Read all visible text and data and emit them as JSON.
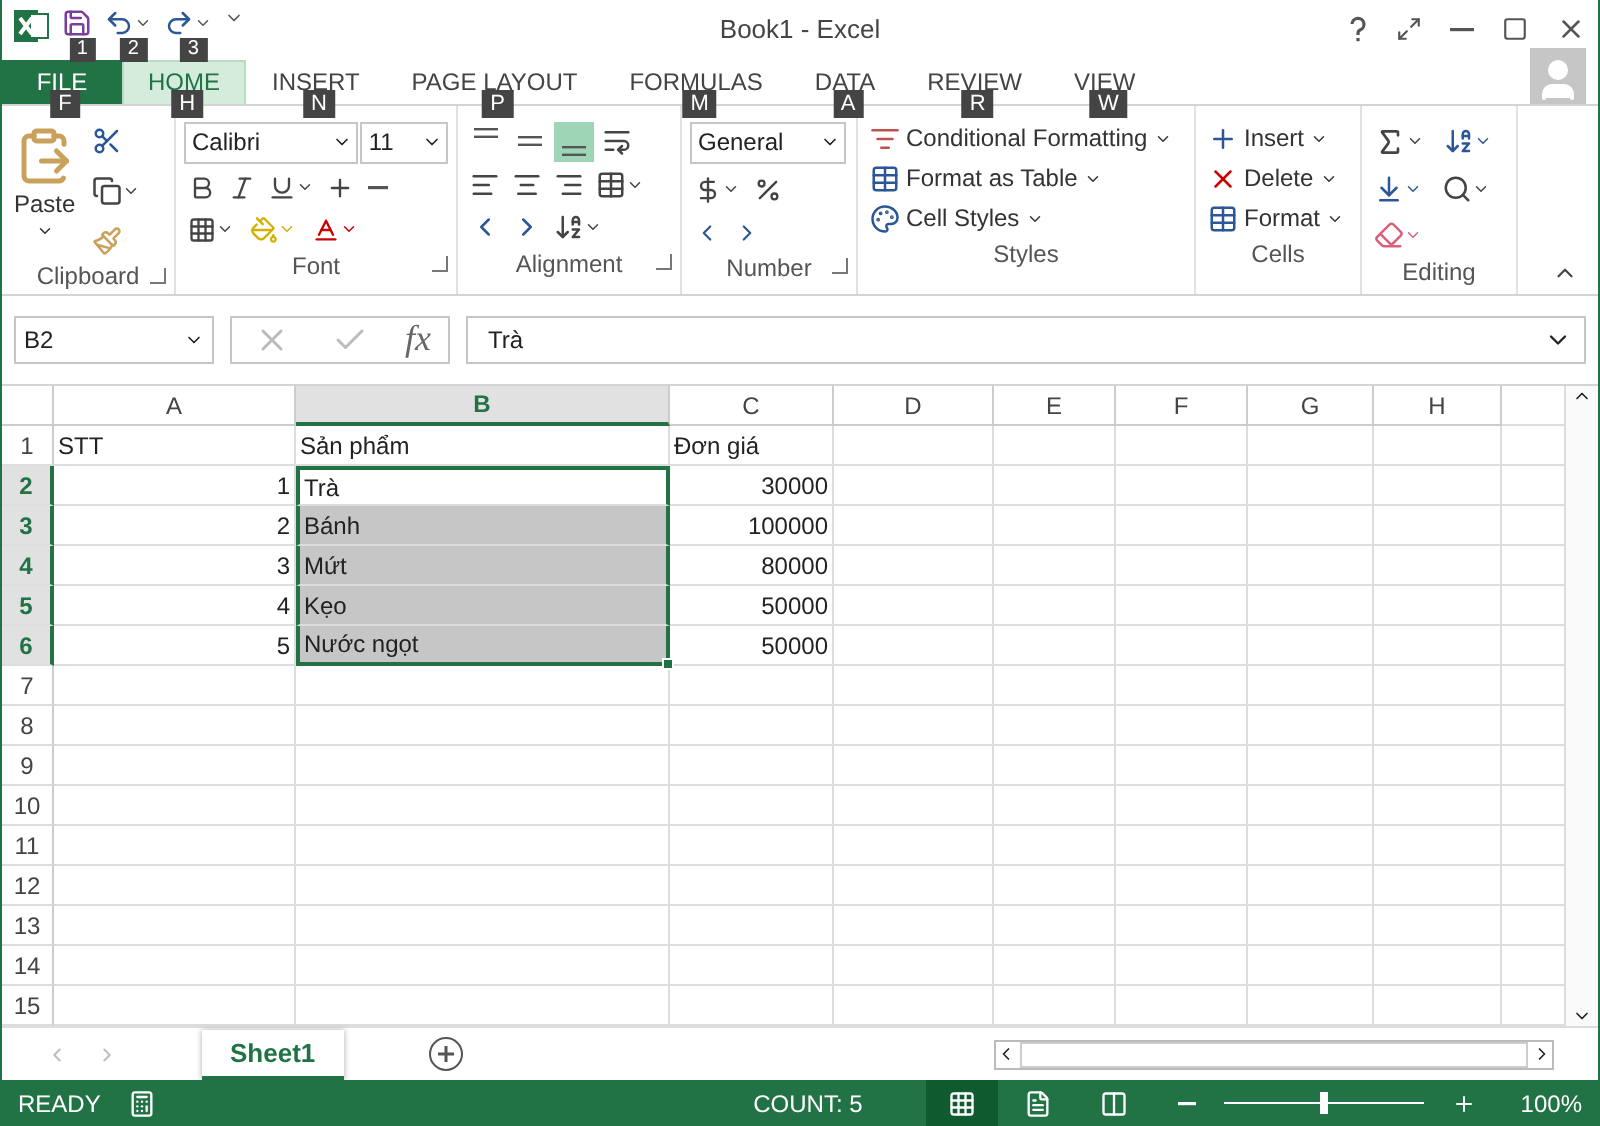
{
  "title_bar": {
    "quick_access": [
      {
        "kind": "save",
        "keytip": "1"
      },
      {
        "kind": "undo",
        "keytip": "2"
      },
      {
        "kind": "redo",
        "keytip": "3"
      }
    ],
    "title": "Book1 - Excel"
  },
  "tabs": [
    {
      "label": "FILE",
      "kind": "file",
      "selected": false,
      "keytip": "F"
    },
    {
      "label": "HOME",
      "kind": "tab",
      "selected": true,
      "keytip": "H"
    },
    {
      "label": "INSERT",
      "kind": "tab",
      "selected": false,
      "keytip": "N"
    },
    {
      "label": "PAGE LAYOUT",
      "kind": "tab",
      "selected": false,
      "keytip": "P"
    },
    {
      "label": "FORMULAS",
      "kind": "tab",
      "selected": false,
      "keytip": "M"
    },
    {
      "label": "DATA",
      "kind": "tab",
      "selected": false,
      "keytip": "A"
    },
    {
      "label": "REVIEW",
      "kind": "tab",
      "selected": false,
      "keytip": "R"
    },
    {
      "label": "VIEW",
      "kind": "tab",
      "selected": false,
      "keytip": "W"
    }
  ],
  "ribbon": {
    "clipboard": {
      "label": "Clipboard",
      "paste": "Paste"
    },
    "font": {
      "label": "Font",
      "font_name": "Calibri",
      "font_size": "11"
    },
    "alignment": {
      "label": "Alignment"
    },
    "number": {
      "label": "Number",
      "format": "General"
    },
    "styles": {
      "label": "Styles",
      "items": [
        "Conditional Formatting",
        "Format as Table",
        "Cell Styles"
      ]
    },
    "cells": {
      "label": "Cells",
      "items": [
        "Insert",
        "Delete",
        "Format"
      ]
    },
    "editing": {
      "label": "Editing"
    }
  },
  "formula_bar": {
    "name_box": "B2",
    "fx": "fx",
    "value": "Trà"
  },
  "grid": {
    "columns": [
      {
        "label": "A",
        "selected": false
      },
      {
        "label": "B",
        "selected": true
      },
      {
        "label": "C",
        "selected": false
      },
      {
        "label": "D",
        "selected": false
      },
      {
        "label": "E",
        "selected": false
      },
      {
        "label": "F",
        "selected": false
      },
      {
        "label": "G",
        "selected": false
      },
      {
        "label": "H",
        "selected": false
      }
    ],
    "rows": [
      {
        "header": "1",
        "selected": false,
        "cells": [
          {
            "text": "STT",
            "kind": "text",
            "selected": false
          },
          {
            "text": "Sản phẩm",
            "kind": "text",
            "selected": false
          },
          {
            "text": "Đơn giá",
            "kind": "text",
            "selected": false
          }
        ]
      },
      {
        "header": "2",
        "selected": true,
        "cells": [
          {
            "text": "1",
            "kind": "number",
            "selected": false
          },
          {
            "text": "Trà",
            "kind": "text",
            "selected": true,
            "active": true
          },
          {
            "text": "30000",
            "kind": "number",
            "selected": false
          }
        ]
      },
      {
        "header": "3",
        "selected": true,
        "cells": [
          {
            "text": "2",
            "kind": "number",
            "selected": false
          },
          {
            "text": "Bánh",
            "kind": "text",
            "selected": true,
            "active": false
          },
          {
            "text": "100000",
            "kind": "number",
            "selected": false
          }
        ]
      },
      {
        "header": "4",
        "selected": true,
        "cells": [
          {
            "text": "3",
            "kind": "number",
            "selected": false
          },
          {
            "text": "Mứt",
            "kind": "text",
            "selected": true,
            "active": false
          },
          {
            "text": "80000",
            "kind": "number",
            "selected": false
          }
        ]
      },
      {
        "header": "5",
        "selected": true,
        "cells": [
          {
            "text": "4",
            "kind": "number",
            "selected": false
          },
          {
            "text": "Kẹo",
            "kind": "text",
            "selected": true,
            "active": false
          },
          {
            "text": "50000",
            "kind": "number",
            "selected": false
          }
        ]
      },
      {
        "header": "6",
        "selected": true,
        "cells": [
          {
            "text": "5",
            "kind": "number",
            "selected": false
          },
          {
            "text": "Nước ngọt",
            "kind": "text",
            "selected": true,
            "active": false
          },
          {
            "text": "50000",
            "kind": "number",
            "selected": false
          }
        ]
      },
      {
        "header": "7",
        "selected": false
      },
      {
        "header": "8",
        "selected": false
      },
      {
        "header": "9",
        "selected": false
      },
      {
        "header": "10",
        "selected": false
      },
      {
        "header": "11",
        "selected": false
      },
      {
        "header": "12",
        "selected": false
      },
      {
        "header": "13",
        "selected": false
      },
      {
        "header": "14",
        "selected": false
      },
      {
        "header": "15",
        "selected": false
      }
    ]
  },
  "sheet_tabs": [
    {
      "label": "Sheet1",
      "selected": true
    }
  ],
  "status_bar": {
    "mode": "READY",
    "count": "COUNT: 5",
    "views": [
      {
        "kind": "normal",
        "selected": true
      },
      {
        "kind": "page_layout",
        "selected": false
      },
      {
        "kind": "page_break",
        "selected": false
      }
    ],
    "zoom": {
      "level": 0.5,
      "reading": "100%"
    }
  }
}
